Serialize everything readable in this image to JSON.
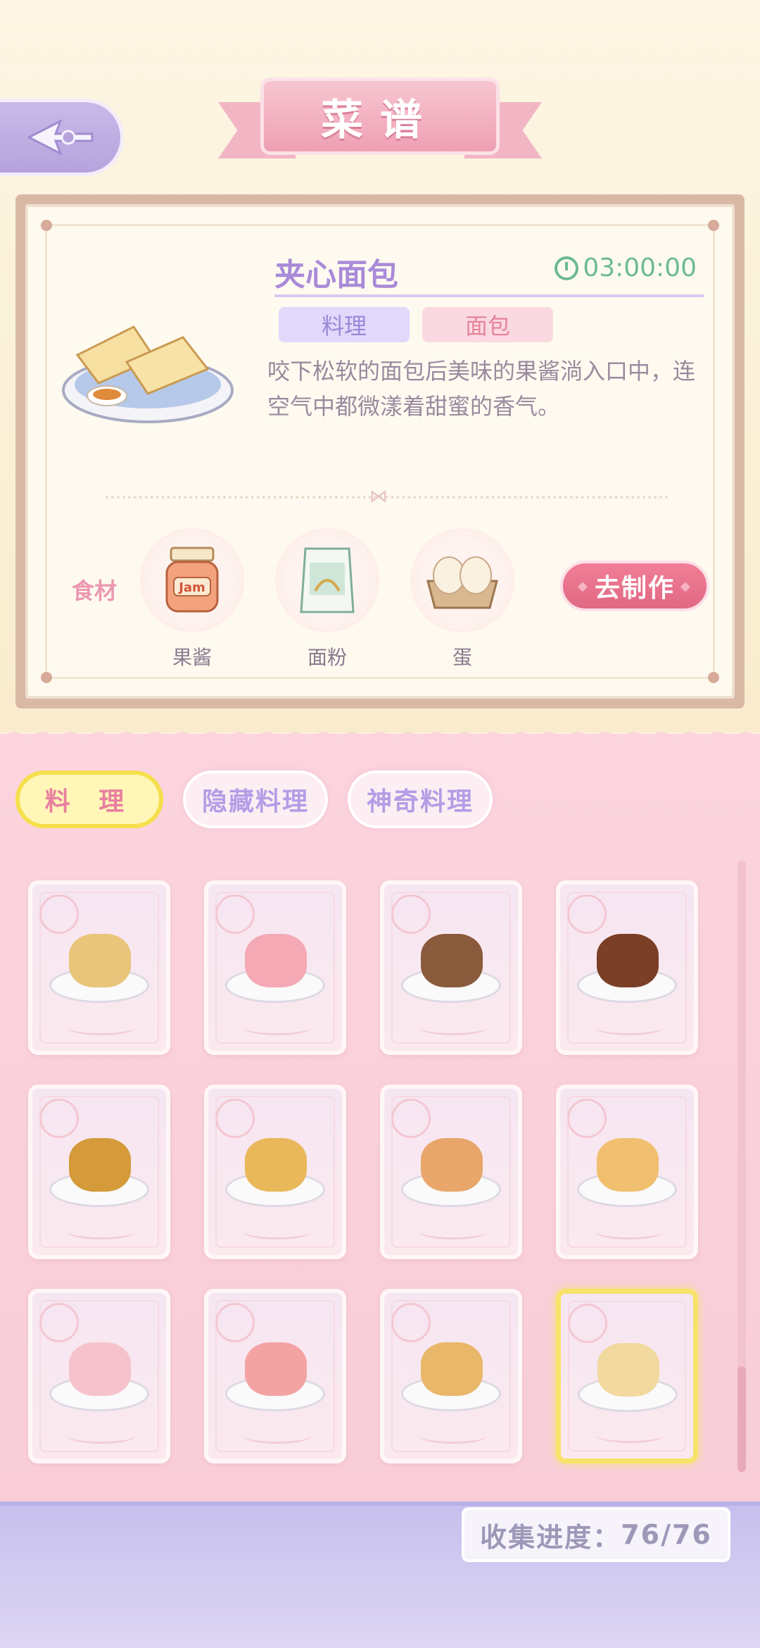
{
  "header": {
    "title": "菜谱"
  },
  "recipe": {
    "name": "夹心面包",
    "time": "03:00:00",
    "category_tag": "料理",
    "subtype_tag": "面包",
    "description": "咬下松软的面包后美味的果酱淌入口中，连空气中都微漾着甜蜜的香气。",
    "ingredients_label": "食材",
    "ingredients": [
      {
        "name": "果酱",
        "icon": "jam-jar-icon"
      },
      {
        "name": "面粉",
        "icon": "flour-bag-icon"
      },
      {
        "name": "蛋",
        "icon": "eggs-icon"
      }
    ],
    "make_button": "去制作"
  },
  "tabs": [
    {
      "label": "料 理",
      "active": true
    },
    {
      "label": "隐藏料理",
      "active": false
    },
    {
      "label": "神奇料理",
      "active": false
    }
  ],
  "dishes": [
    {
      "icon": "taco-icon",
      "color": "#e8c57a"
    },
    {
      "icon": "pink-jelly-icon",
      "color": "#f5a9b5"
    },
    {
      "icon": "meatballs-icon",
      "color": "#8a5a3c"
    },
    {
      "icon": "braised-pork-icon",
      "color": "#7a3f26"
    },
    {
      "icon": "fried-chicken-icon",
      "color": "#d59a3a"
    },
    {
      "icon": "pancake-platter-icon",
      "color": "#e8b85a"
    },
    {
      "icon": "pizza-slice-icon",
      "color": "#e8a66a"
    },
    {
      "icon": "roll-cake-platter-icon",
      "color": "#f0c070"
    },
    {
      "icon": "strawberry-roll-cake-icon",
      "color": "#f6c3cc"
    },
    {
      "icon": "strawberry-pudding-icon",
      "color": "#f4a3a3"
    },
    {
      "icon": "pancake-stack-icon",
      "color": "#e9b76a"
    },
    {
      "icon": "sandwich-bread-icon",
      "color": "#f1d9a0",
      "selected": true
    }
  ],
  "collection": {
    "label": "收集进度：",
    "value": "76/76"
  }
}
